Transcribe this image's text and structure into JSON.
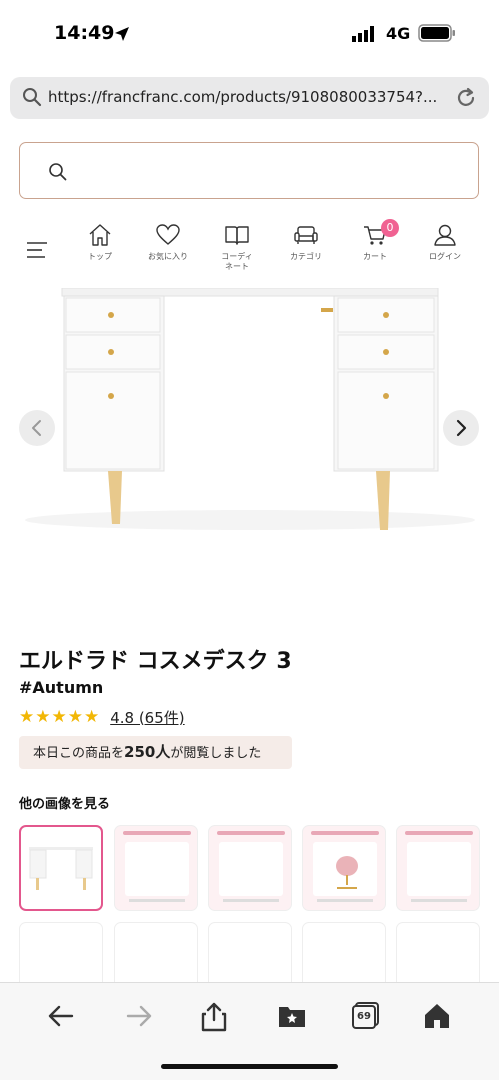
{
  "status": {
    "time": "14:49",
    "network": "4G"
  },
  "browser": {
    "url": "https://francfranc.com/products/9108080033754?..."
  },
  "nav": {
    "items": [
      {
        "label": "トップ",
        "icon": "home-icon"
      },
      {
        "label": "お気に入り",
        "icon": "heart-icon"
      },
      {
        "label": "コーディ\nネート",
        "label1": "コーディ",
        "label2": "ネート",
        "icon": "book-icon"
      },
      {
        "label": "カテゴリ",
        "icon": "sofa-icon"
      },
      {
        "label": "カート",
        "icon": "cart-icon",
        "badge": "0"
      },
      {
        "label": "ログイン",
        "icon": "user-icon"
      }
    ]
  },
  "product": {
    "title": "エルドラド コスメデスク 3",
    "tag": "#Autumn",
    "rating": "4.8 (65件)",
    "stars": 5,
    "views_prefix": "本日この商品を",
    "views_count": "250人",
    "views_suffix": "が閲覧しました"
  },
  "gallery": {
    "heading": "他の画像を見る"
  },
  "toolbar": {
    "tabs_count": "69"
  },
  "colors": {
    "accent_pink": "#f06292",
    "search_border": "#c9a38f",
    "star": "#f2b705"
  }
}
